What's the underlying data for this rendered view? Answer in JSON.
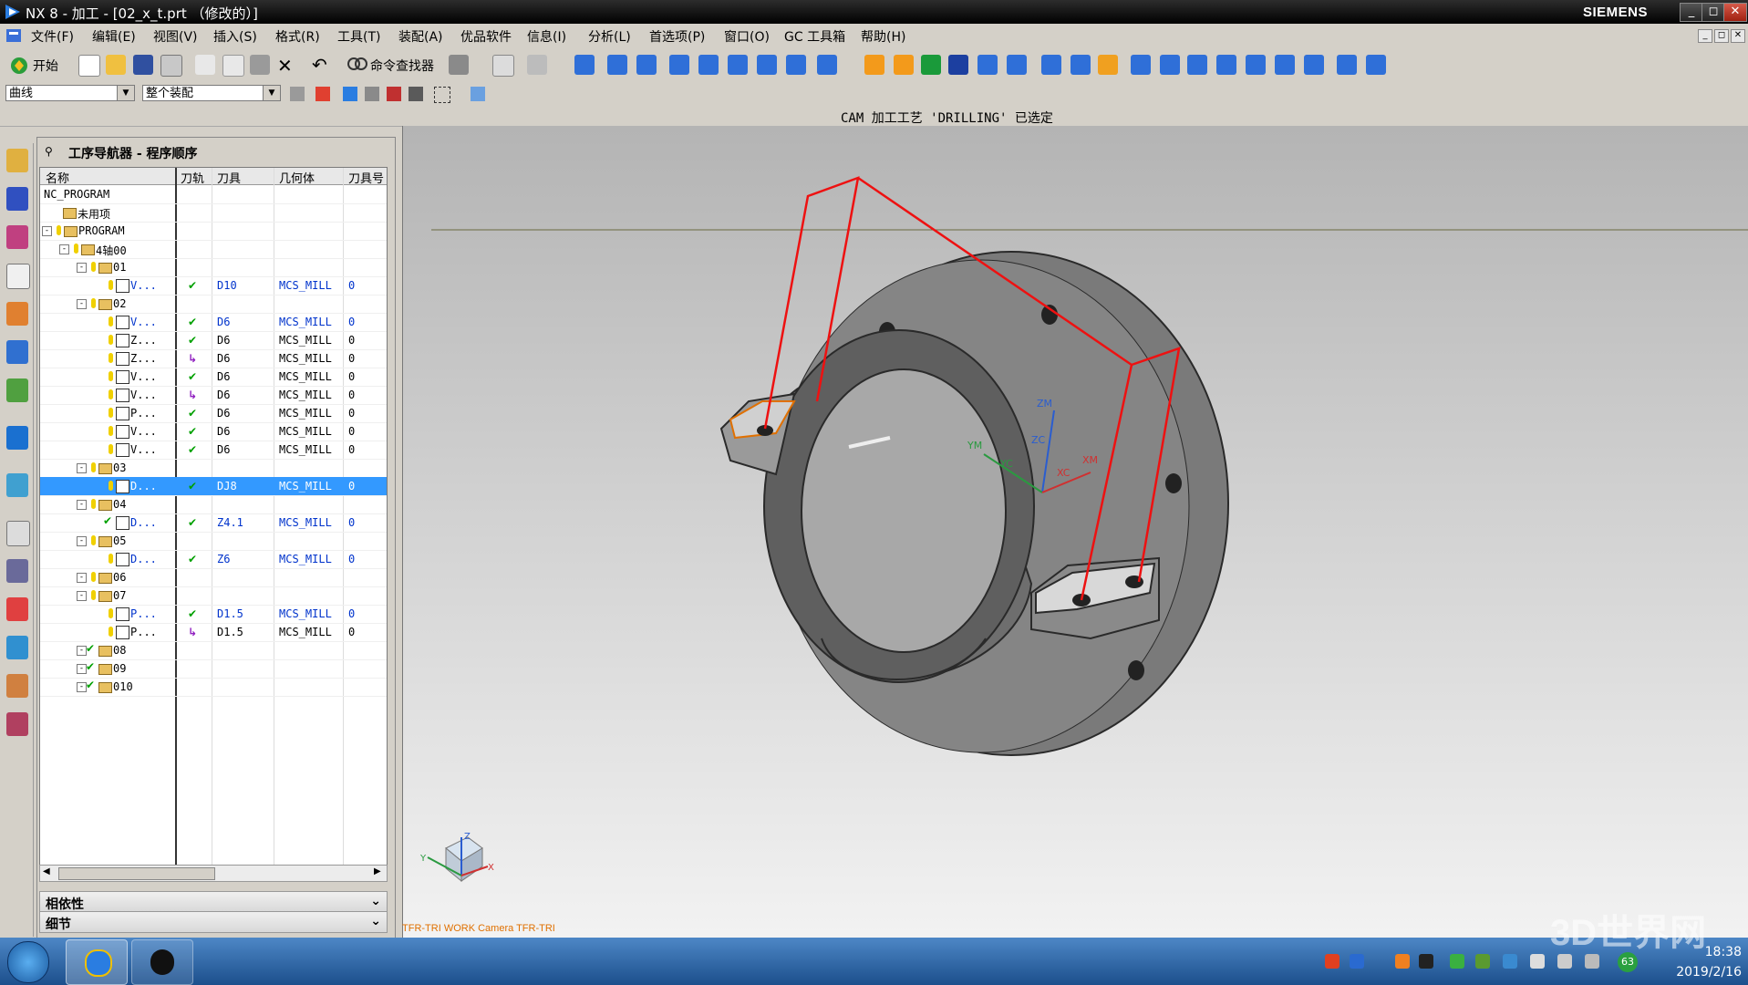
{
  "window": {
    "title": "NX 8 - 加工 - [02_x_t.prt （修改的）]",
    "brand": "SIEMENS",
    "controls": {
      "minimize": "_",
      "restore": "◻",
      "close": "✕"
    }
  },
  "menu": [
    "文件(F)",
    "编辑(E)",
    "视图(V)",
    "插入(S)",
    "格式(R)",
    "工具(T)",
    "装配(A)",
    "优品软件",
    "信息(I)",
    "分析(L)",
    "首选项(P)",
    "窗口(O)",
    "GC 工具箱",
    "帮助(H)"
  ],
  "toolbar": {
    "start_label": "开始",
    "command_finder_label": "命令查找器"
  },
  "selection_bar": {
    "filter_value": "曲线",
    "scope_value": "整个装配"
  },
  "status_line": "CAM 加工工艺 'DRILLING' 已选定",
  "navigator": {
    "title": "工序导航器 - 程序顺序",
    "columns": [
      "名称",
      "刀轨",
      "刀具",
      "几何体",
      "刀具号"
    ],
    "rows": [
      {
        "name": "NC_PROGRAM",
        "path": "",
        "tool": "",
        "geom": "",
        "num": "",
        "indent": 0,
        "kind": "text",
        "sel": false
      },
      {
        "name": "未用项",
        "path": "",
        "tool": "",
        "geom": "",
        "num": "",
        "indent": 1,
        "kind": "folder",
        "sel": false
      },
      {
        "name": "PROGRAM",
        "path": "",
        "tool": "",
        "geom": "",
        "num": "",
        "indent": 0,
        "kind": "group",
        "sel": false
      },
      {
        "name": "4轴00",
        "path": "",
        "tool": "",
        "geom": "",
        "num": "",
        "indent": 1,
        "kind": "group",
        "sel": false
      },
      {
        "name": "01",
        "path": "",
        "tool": "",
        "geom": "",
        "num": "",
        "indent": 2,
        "kind": "group",
        "sel": false
      },
      {
        "name": "V...",
        "path": "ok",
        "tool": "D10",
        "geom": "MCS_MILL",
        "num": "0",
        "indent": 3,
        "kind": "op",
        "sel": false,
        "blue": true
      },
      {
        "name": "02",
        "path": "",
        "tool": "",
        "geom": "",
        "num": "",
        "indent": 2,
        "kind": "group",
        "sel": false
      },
      {
        "name": "V...",
        "path": "ok",
        "tool": "D6",
        "geom": "MCS_MILL",
        "num": "0",
        "indent": 3,
        "kind": "op",
        "sel": false,
        "blue": true
      },
      {
        "name": "Z...",
        "path": "ok",
        "tool": "D6",
        "geom": "MCS_MILL",
        "num": "0",
        "indent": 3,
        "kind": "op",
        "sel": false
      },
      {
        "name": "Z...",
        "path": "re",
        "tool": "D6",
        "geom": "MCS_MILL",
        "num": "0",
        "indent": 3,
        "kind": "op",
        "sel": false
      },
      {
        "name": "V...",
        "path": "ok",
        "tool": "D6",
        "geom": "MCS_MILL",
        "num": "0",
        "indent": 3,
        "kind": "op",
        "sel": false
      },
      {
        "name": "V...",
        "path": "re",
        "tool": "D6",
        "geom": "MCS_MILL",
        "num": "0",
        "indent": 3,
        "kind": "op",
        "sel": false
      },
      {
        "name": "P...",
        "path": "ok",
        "tool": "D6",
        "geom": "MCS_MILL",
        "num": "0",
        "indent": 3,
        "kind": "op",
        "sel": false
      },
      {
        "name": "V...",
        "path": "ok",
        "tool": "D6",
        "geom": "MCS_MILL",
        "num": "0",
        "indent": 3,
        "kind": "op",
        "sel": false
      },
      {
        "name": "V...",
        "path": "ok",
        "tool": "D6",
        "geom": "MCS_MILL",
        "num": "0",
        "indent": 3,
        "kind": "op",
        "sel": false
      },
      {
        "name": "03",
        "path": "",
        "tool": "",
        "geom": "",
        "num": "",
        "indent": 2,
        "kind": "group",
        "sel": false
      },
      {
        "name": "D...",
        "path": "ok",
        "tool": "DJ8",
        "geom": "MCS_MILL",
        "num": "0",
        "indent": 3,
        "kind": "op",
        "sel": true,
        "blue": true
      },
      {
        "name": "04",
        "path": "",
        "tool": "",
        "geom": "",
        "num": "",
        "indent": 2,
        "kind": "group",
        "sel": false
      },
      {
        "name": "D...",
        "path": "ok",
        "tool": "Z4.1",
        "geom": "MCS_MILL",
        "num": "0",
        "indent": 3,
        "kind": "op",
        "sel": false,
        "blue": true,
        "done": true
      },
      {
        "name": "05",
        "path": "",
        "tool": "",
        "geom": "",
        "num": "",
        "indent": 2,
        "kind": "group",
        "sel": false
      },
      {
        "name": "D...",
        "path": "ok",
        "tool": "Z6",
        "geom": "MCS_MILL",
        "num": "0",
        "indent": 3,
        "kind": "op",
        "sel": false,
        "blue": true
      },
      {
        "name": "06",
        "path": "",
        "tool": "",
        "geom": "",
        "num": "",
        "indent": 2,
        "kind": "group",
        "sel": false
      },
      {
        "name": "07",
        "path": "",
        "tool": "",
        "geom": "",
        "num": "",
        "indent": 2,
        "kind": "group",
        "sel": false
      },
      {
        "name": "P...",
        "path": "ok",
        "tool": "D1.5",
        "geom": "MCS_MILL",
        "num": "0",
        "indent": 3,
        "kind": "op",
        "sel": false,
        "blue": true
      },
      {
        "name": "P...",
        "path": "re",
        "tool": "D1.5",
        "geom": "MCS_MILL",
        "num": "0",
        "indent": 3,
        "kind": "op",
        "sel": false
      },
      {
        "name": "08",
        "path": "",
        "tool": "",
        "geom": "",
        "num": "",
        "indent": 2,
        "kind": "group",
        "sel": false,
        "done": true
      },
      {
        "name": "09",
        "path": "",
        "tool": "",
        "geom": "",
        "num": "",
        "indent": 2,
        "kind": "group",
        "sel": false,
        "done": true
      },
      {
        "name": "010",
        "path": "",
        "tool": "",
        "geom": "",
        "num": "",
        "indent": 2,
        "kind": "group",
        "sel": false,
        "done": true
      }
    ],
    "sections": {
      "dependencies": "相依性",
      "details": "细节"
    }
  },
  "graphics": {
    "view_label": "TFR-TRI WORK Camera TFR-TRI",
    "csys_labels": {
      "zm": "ZM",
      "zc": "ZC",
      "ym": "YM",
      "yc": "YC",
      "xc": "XC",
      "xm": "XM"
    },
    "triad_labels": {
      "z": "Z",
      "y": "Y",
      "x": "X"
    }
  },
  "taskbar": {
    "time": "18:38",
    "date": "2019/2/16",
    "watermark": "3D世界网",
    "tray_count": "63"
  },
  "colors": {
    "selection": "#3399ff",
    "toolpath": "#ee1111",
    "path_ok": "#00a000",
    "path_regen": "#9020c0"
  }
}
